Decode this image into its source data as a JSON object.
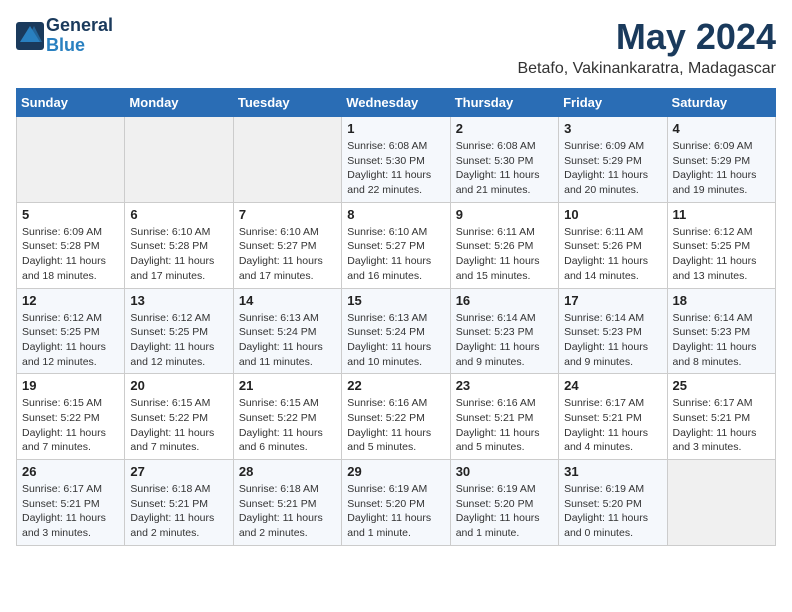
{
  "header": {
    "logo_general": "General",
    "logo_blue": "Blue",
    "month_title": "May 2024",
    "location": "Betafo, Vakinankaratra, Madagascar"
  },
  "days_of_week": [
    "Sunday",
    "Monday",
    "Tuesday",
    "Wednesday",
    "Thursday",
    "Friday",
    "Saturday"
  ],
  "weeks": [
    [
      {
        "day": "",
        "info": ""
      },
      {
        "day": "",
        "info": ""
      },
      {
        "day": "",
        "info": ""
      },
      {
        "day": "1",
        "info": "Sunrise: 6:08 AM\nSunset: 5:30 PM\nDaylight: 11 hours\nand 22 minutes."
      },
      {
        "day": "2",
        "info": "Sunrise: 6:08 AM\nSunset: 5:30 PM\nDaylight: 11 hours\nand 21 minutes."
      },
      {
        "day": "3",
        "info": "Sunrise: 6:09 AM\nSunset: 5:29 PM\nDaylight: 11 hours\nand 20 minutes."
      },
      {
        "day": "4",
        "info": "Sunrise: 6:09 AM\nSunset: 5:29 PM\nDaylight: 11 hours\nand 19 minutes."
      }
    ],
    [
      {
        "day": "5",
        "info": "Sunrise: 6:09 AM\nSunset: 5:28 PM\nDaylight: 11 hours\nand 18 minutes."
      },
      {
        "day": "6",
        "info": "Sunrise: 6:10 AM\nSunset: 5:28 PM\nDaylight: 11 hours\nand 17 minutes."
      },
      {
        "day": "7",
        "info": "Sunrise: 6:10 AM\nSunset: 5:27 PM\nDaylight: 11 hours\nand 17 minutes."
      },
      {
        "day": "8",
        "info": "Sunrise: 6:10 AM\nSunset: 5:27 PM\nDaylight: 11 hours\nand 16 minutes."
      },
      {
        "day": "9",
        "info": "Sunrise: 6:11 AM\nSunset: 5:26 PM\nDaylight: 11 hours\nand 15 minutes."
      },
      {
        "day": "10",
        "info": "Sunrise: 6:11 AM\nSunset: 5:26 PM\nDaylight: 11 hours\nand 14 minutes."
      },
      {
        "day": "11",
        "info": "Sunrise: 6:12 AM\nSunset: 5:25 PM\nDaylight: 11 hours\nand 13 minutes."
      }
    ],
    [
      {
        "day": "12",
        "info": "Sunrise: 6:12 AM\nSunset: 5:25 PM\nDaylight: 11 hours\nand 12 minutes."
      },
      {
        "day": "13",
        "info": "Sunrise: 6:12 AM\nSunset: 5:25 PM\nDaylight: 11 hours\nand 12 minutes."
      },
      {
        "day": "14",
        "info": "Sunrise: 6:13 AM\nSunset: 5:24 PM\nDaylight: 11 hours\nand 11 minutes."
      },
      {
        "day": "15",
        "info": "Sunrise: 6:13 AM\nSunset: 5:24 PM\nDaylight: 11 hours\nand 10 minutes."
      },
      {
        "day": "16",
        "info": "Sunrise: 6:14 AM\nSunset: 5:23 PM\nDaylight: 11 hours\nand 9 minutes."
      },
      {
        "day": "17",
        "info": "Sunrise: 6:14 AM\nSunset: 5:23 PM\nDaylight: 11 hours\nand 9 minutes."
      },
      {
        "day": "18",
        "info": "Sunrise: 6:14 AM\nSunset: 5:23 PM\nDaylight: 11 hours\nand 8 minutes."
      }
    ],
    [
      {
        "day": "19",
        "info": "Sunrise: 6:15 AM\nSunset: 5:22 PM\nDaylight: 11 hours\nand 7 minutes."
      },
      {
        "day": "20",
        "info": "Sunrise: 6:15 AM\nSunset: 5:22 PM\nDaylight: 11 hours\nand 7 minutes."
      },
      {
        "day": "21",
        "info": "Sunrise: 6:15 AM\nSunset: 5:22 PM\nDaylight: 11 hours\nand 6 minutes."
      },
      {
        "day": "22",
        "info": "Sunrise: 6:16 AM\nSunset: 5:22 PM\nDaylight: 11 hours\nand 5 minutes."
      },
      {
        "day": "23",
        "info": "Sunrise: 6:16 AM\nSunset: 5:21 PM\nDaylight: 11 hours\nand 5 minutes."
      },
      {
        "day": "24",
        "info": "Sunrise: 6:17 AM\nSunset: 5:21 PM\nDaylight: 11 hours\nand 4 minutes."
      },
      {
        "day": "25",
        "info": "Sunrise: 6:17 AM\nSunset: 5:21 PM\nDaylight: 11 hours\nand 3 minutes."
      }
    ],
    [
      {
        "day": "26",
        "info": "Sunrise: 6:17 AM\nSunset: 5:21 PM\nDaylight: 11 hours\nand 3 minutes."
      },
      {
        "day": "27",
        "info": "Sunrise: 6:18 AM\nSunset: 5:21 PM\nDaylight: 11 hours\nand 2 minutes."
      },
      {
        "day": "28",
        "info": "Sunrise: 6:18 AM\nSunset: 5:21 PM\nDaylight: 11 hours\nand 2 minutes."
      },
      {
        "day": "29",
        "info": "Sunrise: 6:19 AM\nSunset: 5:20 PM\nDaylight: 11 hours\nand 1 minute."
      },
      {
        "day": "30",
        "info": "Sunrise: 6:19 AM\nSunset: 5:20 PM\nDaylight: 11 hours\nand 1 minute."
      },
      {
        "day": "31",
        "info": "Sunrise: 6:19 AM\nSunset: 5:20 PM\nDaylight: 11 hours\nand 0 minutes."
      },
      {
        "day": "",
        "info": ""
      }
    ]
  ]
}
